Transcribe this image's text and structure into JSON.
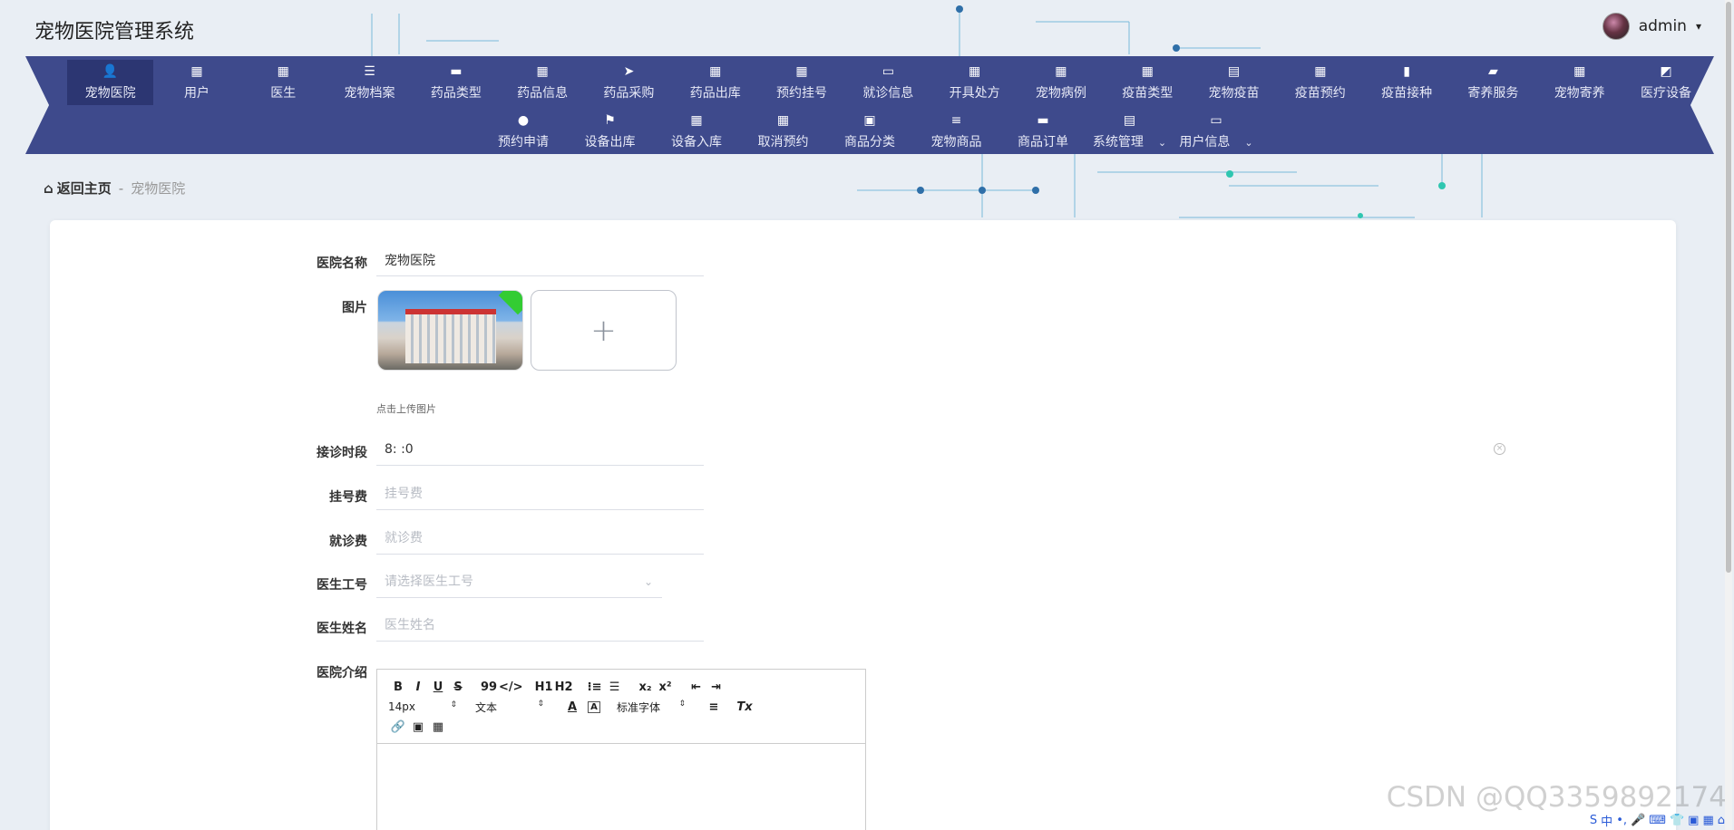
{
  "app": {
    "title": "宠物医院管理系统"
  },
  "user": {
    "name": "admin",
    "caret": "▾"
  },
  "nav": {
    "row1": [
      {
        "label": "宠物医院",
        "icon": "👤",
        "icon_name": "user-icon"
      },
      {
        "label": "用户",
        "icon": "▦",
        "icon_name": "grid-icon"
      },
      {
        "label": "医生",
        "icon": "▦",
        "icon_name": "grid-icon"
      },
      {
        "label": "宠物档案",
        "icon": "☰",
        "icon_name": "list-icon"
      },
      {
        "label": "药品类型",
        "icon": "▬",
        "icon_name": "monitor-icon"
      },
      {
        "label": "药品信息",
        "icon": "▦",
        "icon_name": "grid-icon"
      },
      {
        "label": "药品采购",
        "icon": "➤",
        "icon_name": "send-icon"
      },
      {
        "label": "药品出库",
        "icon": "▦",
        "icon_name": "grid-icon"
      },
      {
        "label": "预约挂号",
        "icon": "▦",
        "icon_name": "grid-icon"
      },
      {
        "label": "就诊信息",
        "icon": "▭",
        "icon_name": "monitor-icon"
      },
      {
        "label": "开具处方",
        "icon": "▦",
        "icon_name": "grid-icon"
      },
      {
        "label": "宠物病例",
        "icon": "▦",
        "icon_name": "grid-icon"
      },
      {
        "label": "疫苗类型",
        "icon": "▦",
        "icon_name": "grid-icon"
      },
      {
        "label": "宠物疫苗",
        "icon": "▤",
        "icon_name": "clipboard-icon"
      },
      {
        "label": "疫苗预约",
        "icon": "▦",
        "icon_name": "grid-icon"
      },
      {
        "label": "疫苗接种",
        "icon": "▮",
        "icon_name": "bar-chart-icon"
      },
      {
        "label": "寄养服务",
        "icon": "▰",
        "icon_name": "wallet-icon"
      },
      {
        "label": "宠物寄养",
        "icon": "▦",
        "icon_name": "grid-icon"
      },
      {
        "label": "医疗设备",
        "icon": "◩",
        "icon_name": "line-chart-icon"
      }
    ],
    "row2": [
      {
        "label": "预约申请",
        "icon": "●",
        "icon_name": "bulb-icon"
      },
      {
        "label": "设备出库",
        "icon": "⚑",
        "icon_name": "flag-icon"
      },
      {
        "label": "设备入库",
        "icon": "▦",
        "icon_name": "grid-icon"
      },
      {
        "label": "取消预约",
        "icon": "▦",
        "icon_name": "grid-icon"
      },
      {
        "label": "商品分类",
        "icon": "▣",
        "icon_name": "box-icon"
      },
      {
        "label": "宠物商品",
        "icon": "≡",
        "icon_name": "sliders-icon"
      },
      {
        "label": "商品订单",
        "icon": "▬",
        "icon_name": "chat-icon"
      },
      {
        "label": "系统管理",
        "icon": "▤",
        "icon_name": "clipboard-icon",
        "dropdown": "⌄"
      },
      {
        "label": "用户信息",
        "icon": "▭",
        "icon_name": "window-icon",
        "dropdown": "⌄"
      }
    ]
  },
  "breadcrumb": {
    "home": "返回主页",
    "separator": "-",
    "current": "宠物医院"
  },
  "form": {
    "name_label": "医院名称",
    "name_value": "宠物医院",
    "image_label": "图片",
    "upload_plus": "+",
    "upload_hint": "点击上传图片",
    "hours_label": "接诊时段",
    "hours_value": "8: :0",
    "clear_glyph": "×",
    "reg_fee_label": "挂号费",
    "reg_fee_placeholder": "挂号费",
    "visit_fee_label": "就诊费",
    "visit_fee_placeholder": "就诊费",
    "doctor_id_label": "医生工号",
    "doctor_id_placeholder": "请选择医生工号",
    "select_arrow": "⌄",
    "doctor_name_label": "医生姓名",
    "doctor_name_placeholder": "医生姓名",
    "intro_label": "医院介绍"
  },
  "editor": {
    "buttons_row1": [
      "B",
      "I",
      "U",
      "S",
      "99",
      "</>",
      "H1",
      "H2",
      "⁝≡",
      "☰",
      "x₂",
      "x²",
      "⇤",
      "⇥"
    ],
    "font_size": "14px",
    "text_style": "文本",
    "font_color": "A",
    "bg_color": "A",
    "font_family": "标准字体",
    "align": "≡",
    "clear_format": "Tx",
    "select_arrow": "⇕",
    "buttons_row3": [
      "🔗",
      "▣",
      "▦"
    ]
  },
  "watermark": "CSDN @QQ3359892174",
  "tray": [
    "S",
    "中",
    "•,",
    "🎤",
    "⌨",
    "👕",
    "▣",
    "▦",
    "⌂"
  ]
}
